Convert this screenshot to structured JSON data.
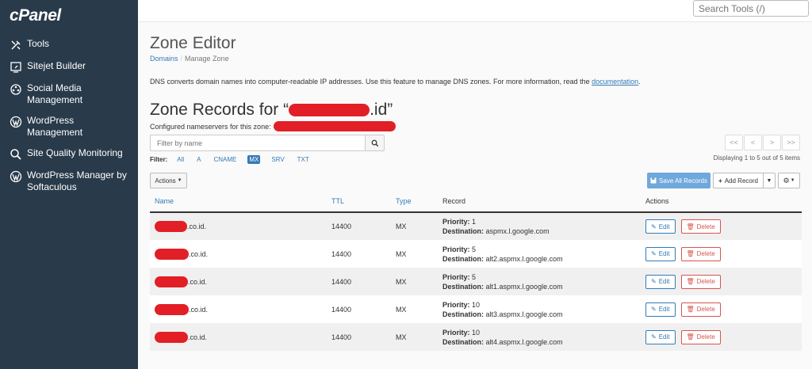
{
  "app": {
    "logo": "cPanel"
  },
  "sidebar": {
    "items": [
      {
        "label": "Tools",
        "icon": "tools-icon"
      },
      {
        "label": "Sitejet Builder",
        "icon": "sitejet-icon"
      },
      {
        "label": "Social Media Management",
        "icon": "social-media-icon"
      },
      {
        "label": "WordPress Management",
        "icon": "wordpress-icon"
      },
      {
        "label": "Site Quality Monitoring",
        "icon": "magnifier-icon"
      },
      {
        "label": "WordPress Manager by Softaculous",
        "icon": "wordpress-icon"
      }
    ]
  },
  "topbar": {
    "search_placeholder": "Search Tools (/)"
  },
  "page": {
    "title": "Zone Editor",
    "breadcrumb": {
      "root": "Domains",
      "separator": "/",
      "current": "Manage Zone"
    },
    "description_text": "DNS converts domain names into computer-readable IP addresses. Use this feature to manage DNS zones. For more information, read the ",
    "description_link": "documentation",
    "description_end": ".",
    "zone_heading_prefix": "Zone Records for “",
    "zone_heading_suffix": ".id”",
    "nameservers_label": "Configured nameservers for this zone:"
  },
  "filter": {
    "placeholder": "Filter by name",
    "label": "Filter:",
    "types": [
      "All",
      "A",
      "CNAME",
      "MX",
      "SRV",
      "TXT"
    ],
    "active_type": "MX"
  },
  "pager": {
    "first": "<<",
    "prev": "<",
    "next": ">",
    "last": ">>",
    "display_info": "Displaying 1 to 5 out of 5 items"
  },
  "toolbar": {
    "actions_label": "Actions",
    "save_all_label": "Save All Records",
    "add_record_label": "Add Record"
  },
  "table": {
    "headers": {
      "name": "Name",
      "ttl": "TTL",
      "type": "Type",
      "record": "Record",
      "actions": "Actions"
    },
    "priority_label": "Priority:",
    "destination_label": "Destination:",
    "edit_label": "Edit",
    "delete_label": "Delete",
    "rows": [
      {
        "name": ".co.id.",
        "ttl": "14400",
        "type": "MX",
        "priority": "1",
        "destination": "aspmx.l.google.com"
      },
      {
        "name": ".co.id.",
        "ttl": "14400",
        "type": "MX",
        "priority": "5",
        "destination": "alt2.aspmx.l.google.com"
      },
      {
        "name": ".co.id.",
        "ttl": "14400",
        "type": "MX",
        "priority": "5",
        "destination": "alt1.aspmx.l.google.com"
      },
      {
        "name": ".co.id.",
        "ttl": "14400",
        "type": "MX",
        "priority": "10",
        "destination": "alt3.aspmx.l.google.com"
      },
      {
        "name": ".co.id.",
        "ttl": "14400",
        "type": "MX",
        "priority": "10",
        "destination": "alt4.aspmx.l.google.com"
      }
    ]
  },
  "colors": {
    "sidebar_bg": "#293a4a",
    "link": "#337ab7",
    "danger": "#d9534f",
    "redaction": "#e21f26",
    "primary_button": "#6fa8dc"
  }
}
